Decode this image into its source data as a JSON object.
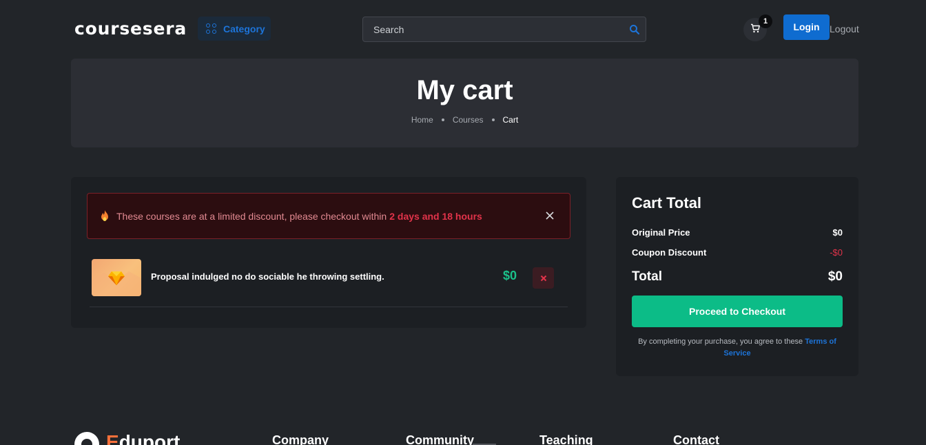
{
  "header": {
    "logo": "coursesera",
    "category_label": "Category",
    "search_placeholder": "Search",
    "cart_count": "1",
    "login_label": "Login",
    "logout_label": "Logout"
  },
  "hero": {
    "title": "My cart",
    "breadcrumb": [
      "Home",
      "Courses",
      "Cart"
    ]
  },
  "alert": {
    "message": "These courses are at a limited discount, please checkout within",
    "highlight": "2 days and 18 hours"
  },
  "cart_items": [
    {
      "title": "Proposal indulged no do sociable he throwing settling.",
      "price": "$0"
    }
  ],
  "cart_total": {
    "heading": "Cart Total",
    "original_price_label": "Original Price",
    "original_price": "$0",
    "coupon_label": "Coupon Discount",
    "coupon_value": "-$0",
    "total_label": "Total",
    "total_value": "$0",
    "checkout_label": "Proceed to Checkout",
    "terms_text": "By completing your purchase, you agree to these",
    "terms_link": "Terms of Service"
  },
  "footer": {
    "logo_initial": "E",
    "logo_rest": "duport",
    "columns": [
      "Company",
      "Community",
      "Teaching",
      "Contact"
    ]
  },
  "colors": {
    "background": "#222529",
    "card": "#1c1f23",
    "primary": "#0f6cd0",
    "success": "#0cbc87",
    "danger": "#e2334a"
  }
}
